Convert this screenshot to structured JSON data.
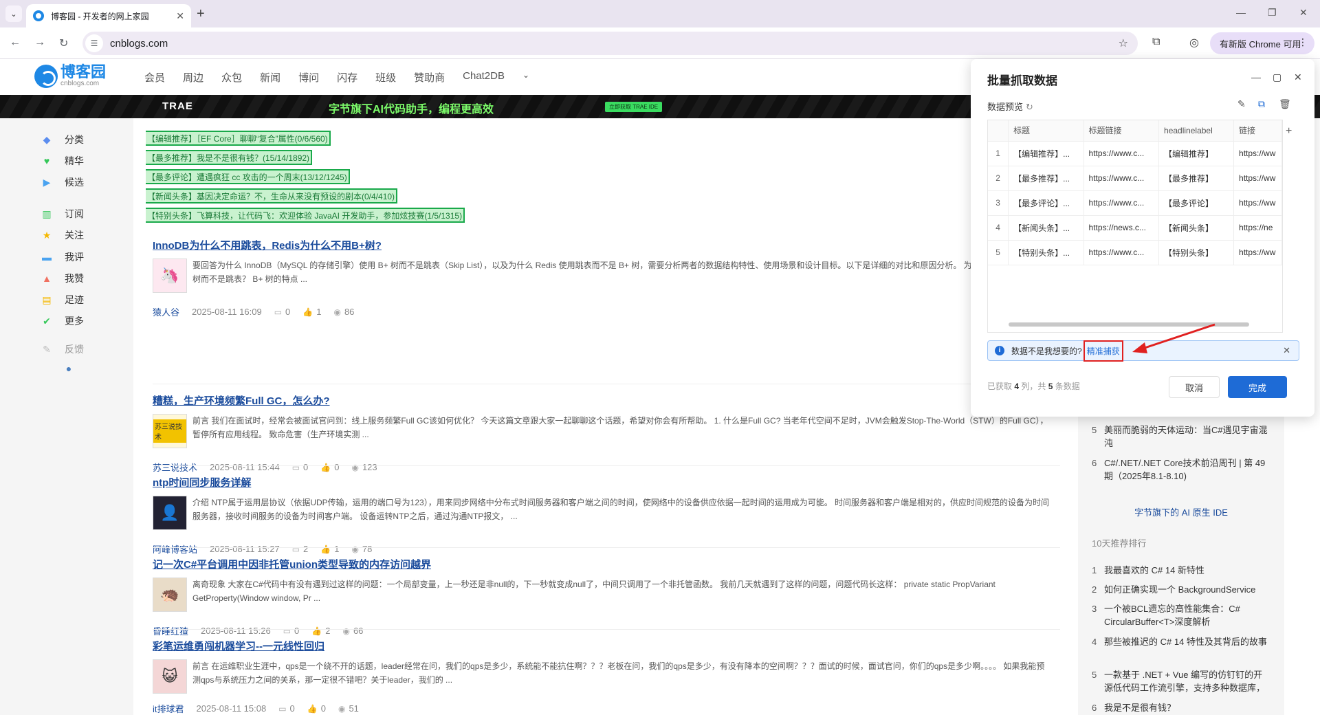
{
  "browser": {
    "tab_title": "博客园 - 开发者的网上家园",
    "url": "cnblogs.com",
    "update_label": "有新版 Chrome 可用"
  },
  "site": {
    "logo_cn": "博客园",
    "logo_en": "cnblogs.com",
    "nav": [
      "会员",
      "周边",
      "众包",
      "新闻",
      "博问",
      "闪存",
      "班级",
      "赞助商",
      "Chat2DB"
    ],
    "banner_brand": "TRAE",
    "banner_slogan": "字节旗下AI代码助手，编程更高效",
    "banner_cta": "立即获取 TRAE IDE"
  },
  "leftbar": [
    "分类",
    "精华",
    "候选",
    "订阅",
    "关注",
    "我评",
    "我赞",
    "足迹",
    "更多",
    "反馈"
  ],
  "headlines": [
    "【编辑推荐】［EF Core］聊聊“复合”属性(0/6/560)",
    "【最多推荐】我是不是很有钱？(15/14/1892)",
    "【最多评论】遭遇疯狂 cc 攻击的一个周末(13/12/1245)",
    "【新闻头条】基因决定命运？不，生命从来没有预设的剧本(0/4/410)",
    "【特别头条】飞算科技，让代码飞：欢迎体验 JavaAI 开发助手，参加炫技赛(1/5/1315)"
  ],
  "posts": [
    {
      "title": "InnoDB为什么不用跳表，Redis为什么不用B+树?",
      "summary": "要回答为什么 InnoDB（MySQL 的存储引擎）使用 B+ 树而不是跳表（Skip List），以及为什么 Redis 使用跳表而不是 B+ 树，需要分析两者的数据结构特性、使用场景和设计目标。以下是详细的对比和原因分析。 为什么 InnoDB 使用 B+ 树而不是跳表？ B+ 树的特点 ...",
      "author": "猿人谷",
      "date": "2025-08-11 16:09",
      "comments": "0",
      "likes": "1",
      "views": "86"
    },
    {
      "title": "糟糕，生产环境频繁Full GC，怎么办?",
      "summary": "前言 我们在面试时，经常会被面试官问到：线上服务频繁Full GC该如何优化？ 今天这篇文章跟大家一起聊聊这个话题，希望对你会有所帮助。 1. 什么是Full GC? 当老年代空间不足时，JVM会触发Stop-The-World（STW）的Full GC），暂停所有应用线程。 致命危害（生产环境实测 ...",
      "author": "苏三说技术",
      "date": "2025-08-11 15:44",
      "comments": "0",
      "likes": "0",
      "views": "123"
    },
    {
      "title": "ntp时间同步服务详解",
      "summary": "介绍 NTP属于运用层协议（依据UDP传输，运用的端口号为123），用来同步网络中分布式时间服务器和客户端之间的时间，使网络中的设备供应依据一起时间的运用成为可能。 时间服务器和客户端是相对的，供应时间规范的设备为时间服务器，接收时间服务的设备为时间客户端。 设备运转NTP之后，通过沟通NTP报文， ...",
      "author": "阿峰博客站",
      "date": "2025-08-11 15:27",
      "comments": "2",
      "likes": "1",
      "views": "78"
    },
    {
      "title": "记一次C#平台调用中因非托管union类型导致的内存访问越界",
      "summary": "离奇现象 大家在C#代码中有没有遇到过这样的问题：一个局部变量，上一秒还是非null的，下一秒就变成null了，中间只调用了一个非托管函数。 我前几天就遇到了这样的问题，问题代码长这样： private static PropVariant GetProperty(Window window, Pr ...",
      "author": "昏睡红猹",
      "date": "2025-08-11 15:26",
      "comments": "0",
      "likes": "2",
      "views": "66"
    },
    {
      "title": "彩笔运维勇闯机器学习--一元线性回归",
      "summary": "前言 在运维职业生涯中，qps是一个绕不开的话题，leader经常在问，我们的qps是多少，系统能不能抗住啊？？？老板在问，我们的qps是多少，有没有降本的空间啊？？？面试的时候，面试官问，你们的qps是多少啊。。。。 如果我能预测qps与系统压力之间的关系，那一定很不错吧？关于leader，我们的 ...",
      "author": "it排球君",
      "date": "2025-08-11 15:08",
      "comments": "0",
      "likes": "0",
      "views": "51"
    }
  ],
  "rightbar": {
    "top_items": [
      {
        "num": "5",
        "text": "美丽而脆弱的天体运动：当C#遇见宇宙混沌"
      },
      {
        "num": "6",
        "text": "C#/.NET/.NET Core技术前沿周刊 | 第 49 期（2025年8.1-8.10)"
      }
    ],
    "promo": "字节旗下的 AI 原生 IDE",
    "section_title": "10天推荐排行",
    "ranking": [
      {
        "num": "1",
        "text": "我最喜欢的 C# 14 新特性"
      },
      {
        "num": "2",
        "text": "如何正确实现一个 BackgroundService"
      },
      {
        "num": "3",
        "text": "一个被BCL遗忘的高性能集合：C# CircularBuffer<T>深度解析"
      },
      {
        "num": "4",
        "text": "那些被推迟的 C# 14 特性及其背后的故事"
      },
      {
        "num": "5",
        "text": "一款基于 .NET + Vue 编写的仿钉钉的开源低代码工作流引擎，支持多种数据库，"
      },
      {
        "num": "6",
        "text": "我是不是很有钱？"
      }
    ]
  },
  "dialog": {
    "title": "批量抓取数据",
    "subtitle": "数据预览",
    "columns": [
      "标题",
      "标题链接",
      "headlinelabel",
      "链接"
    ],
    "rows": [
      {
        "idx": "1",
        "c1": "【编辑推荐】...",
        "c2": "https://www.c...",
        "c3": "【编辑推荐】",
        "c4": "https://ww"
      },
      {
        "idx": "2",
        "c1": "【最多推荐】...",
        "c2": "https://www.c...",
        "c3": "【最多推荐】",
        "c4": "https://ww"
      },
      {
        "idx": "3",
        "c1": "【最多评论】...",
        "c2": "https://www.c...",
        "c3": "【最多评论】",
        "c4": "https://ww"
      },
      {
        "idx": "4",
        "c1": "【新闻头条】...",
        "c2": "https://news.c...",
        "c3": "【新闻头条】",
        "c4": "https://ne"
      },
      {
        "idx": "5",
        "c1": "【特别头条】...",
        "c2": "https://www.c...",
        "c3": "【特别头条】",
        "c4": "https://ww"
      }
    ],
    "notice_text": "数据不是我想要的?",
    "notice_link": "精准捕获",
    "status_prefix": "已获取",
    "status_cols": "4",
    "status_mid": "列，共",
    "status_rows": "5",
    "status_suffix": "条数据",
    "cancel": "取消",
    "done": "完成"
  },
  "colors": {
    "accent": "#1e6bd6",
    "headline_outline": "#19a94a",
    "highlight_red": "#e02020"
  }
}
